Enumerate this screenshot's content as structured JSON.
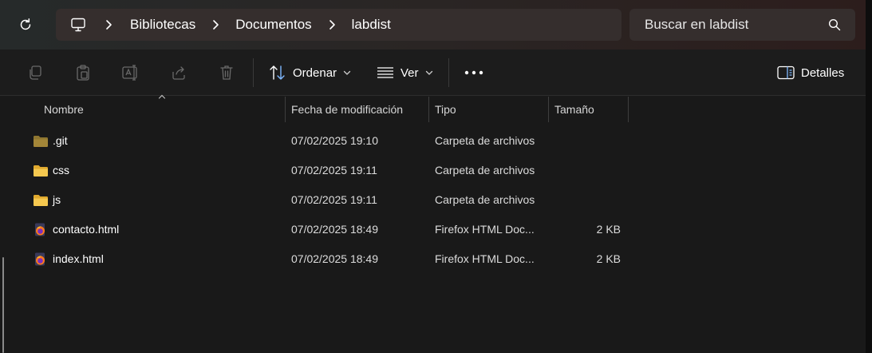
{
  "address_bar": {
    "breadcrumbs": [
      "Bibliotecas",
      "Documentos",
      "labdist"
    ]
  },
  "search": {
    "placeholder": "Buscar en labdist"
  },
  "toolbar": {
    "sort_label": "Ordenar",
    "view_label": "Ver",
    "details_label": "Detalles",
    "icons": [
      "copy-icon",
      "paste-icon",
      "rename-icon",
      "share-icon",
      "delete-icon",
      "sort-icon",
      "view-icon",
      "more-icon",
      "details-pane-icon"
    ]
  },
  "columns": {
    "name": "Nombre",
    "date": "Fecha de modificación",
    "type": "Tipo",
    "size": "Tamaño"
  },
  "files": [
    {
      "name": ".git",
      "date": "07/02/2025 19:10",
      "type": "Carpeta de archivos",
      "size": "",
      "icon": "folder-dark-icon"
    },
    {
      "name": "css",
      "date": "07/02/2025 19:11",
      "type": "Carpeta de archivos",
      "size": "",
      "icon": "folder-icon"
    },
    {
      "name": "js",
      "date": "07/02/2025 19:11",
      "type": "Carpeta de archivos",
      "size": "",
      "icon": "folder-icon"
    },
    {
      "name": "contacto.html",
      "date": "07/02/2025 18:49",
      "type": "Firefox HTML Doc...",
      "size": "2 KB",
      "icon": "firefox-html-icon"
    },
    {
      "name": "index.html",
      "date": "07/02/2025 18:49",
      "type": "Firefox HTML Doc...",
      "size": "2 KB",
      "icon": "firefox-html-icon"
    }
  ],
  "colors": {
    "folder": "#f0c24b",
    "folder_dark": "#a08436",
    "address_bg": "#352e2d"
  }
}
